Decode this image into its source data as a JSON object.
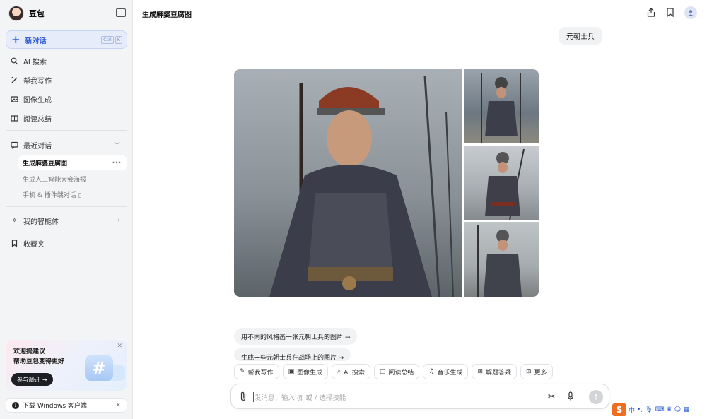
{
  "brand": {
    "name": "豆包"
  },
  "new_chat": {
    "label": "新对话",
    "shortcut": [
      "Ctrl",
      "K"
    ]
  },
  "nav": [
    {
      "label": "AI 搜索",
      "icon": "search-icon"
    },
    {
      "label": "帮我写作",
      "icon": "pen-icon"
    },
    {
      "label": "图像生成",
      "icon": "image-icon"
    },
    {
      "label": "阅读总结",
      "icon": "book-icon"
    }
  ],
  "recent": {
    "label": "最近对话",
    "items": [
      "生成麻婆豆腐图",
      "生成人工智能大会海报",
      "手机 & 插件端对话 ▯"
    ]
  },
  "agents": {
    "label": "我的智能体"
  },
  "favorites": {
    "label": "收藏夹"
  },
  "promo": {
    "line1": "欢迎提建议",
    "line2": "帮助豆包变得更好",
    "button": "参与调研",
    "hash": "#"
  },
  "download": {
    "label": "下载 Windows 客户端"
  },
  "header": {
    "title": "生成麻婆豆腐图"
  },
  "user_message": "元朝士兵",
  "suggestions": [
    "用不同的风格画一张元朝士兵的图片 →",
    "生成一些元朝士兵在战场上的图片 →"
  ],
  "tools": [
    "帮我写作",
    "图像生成",
    "AI 搜索",
    "阅读总结",
    "音乐生成",
    "解题答疑",
    "更多"
  ],
  "composer": {
    "placeholder": "发消息、输入 @ 或 / 选择技能"
  },
  "ime": {
    "lang": "中"
  }
}
